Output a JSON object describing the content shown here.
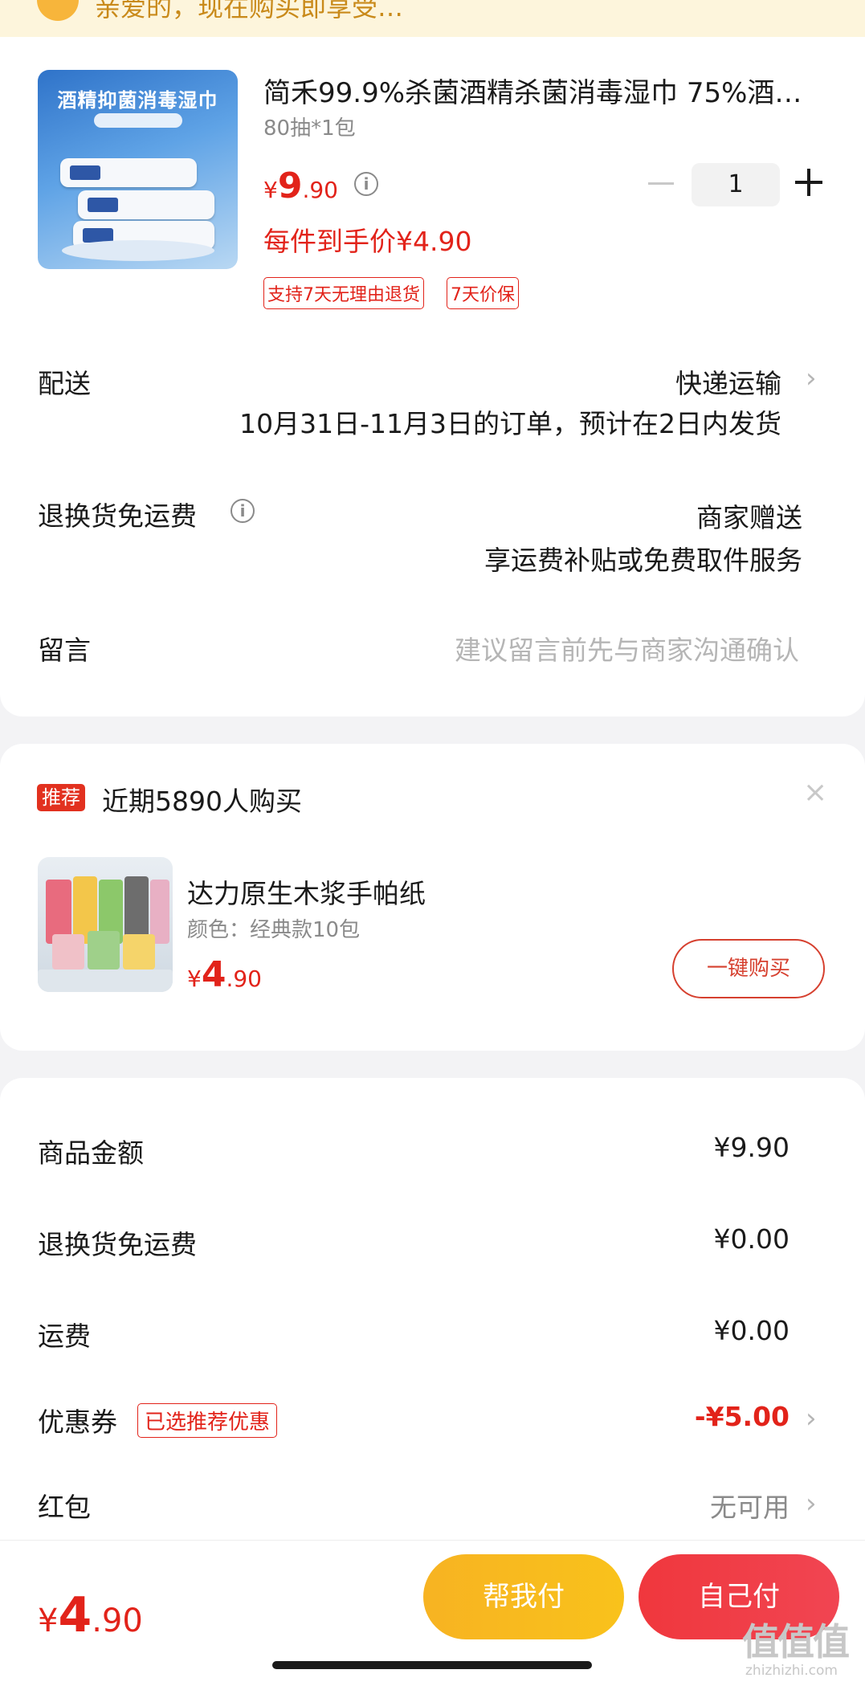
{
  "top_banner": {
    "text": "亲爱的，现在购买即享受…"
  },
  "product": {
    "image_banner": "酒精抑菌消毒湿巾",
    "title": "简禾99.9%杀菌酒精杀菌消毒湿巾 75%酒…",
    "spec": "80抽*1包",
    "price_yen": "¥",
    "price_int": "9",
    "price_dec": ".90",
    "quantity": "1",
    "unit_price": "每件到手价¥4.90",
    "tags": [
      "支持7天无理由退货",
      "7天价保"
    ]
  },
  "delivery": {
    "label": "配送",
    "method": "快递运输",
    "note": "10月31日-11月3日的订单，预计在2日内发货"
  },
  "return_shipping": {
    "label": "退换货免运费",
    "value": "商家赠送",
    "note": "享运费补贴或免费取件服务"
  },
  "message": {
    "label": "留言",
    "placeholder": "建议留言前先与商家沟通确认"
  },
  "recommend": {
    "badge": "推荐",
    "title": "近期5890人购买",
    "close": "×",
    "product_name": "达力原生木浆手帕纸",
    "product_spec": "颜色：经典款10包",
    "price_yen": "¥",
    "price_int": "4",
    "price_dec": ".90",
    "buy_label": "一键购买"
  },
  "summary": {
    "goods_label": "商品金额",
    "goods_value": "¥9.90",
    "return_label": "退换货免运费",
    "return_value": "¥0.00",
    "shipping_label": "运费",
    "shipping_value": "¥0.00",
    "coupon_label": "优惠券",
    "coupon_tag": "已选推荐优惠",
    "coupon_value": "-¥5.00",
    "redpacket_label": "红包",
    "redpacket_value": "无可用"
  },
  "bottom": {
    "total_yen": "¥",
    "total_int": "4",
    "total_dec": ".90",
    "help_pay": "帮我付",
    "self_pay": "自己付"
  },
  "watermark": {
    "logo": "值值值",
    "url": "zhizhizhi.com"
  },
  "colors": {
    "accent_red": "#e2231a",
    "help_yellow": "#f7b322",
    "self_red": "#f0373d"
  }
}
